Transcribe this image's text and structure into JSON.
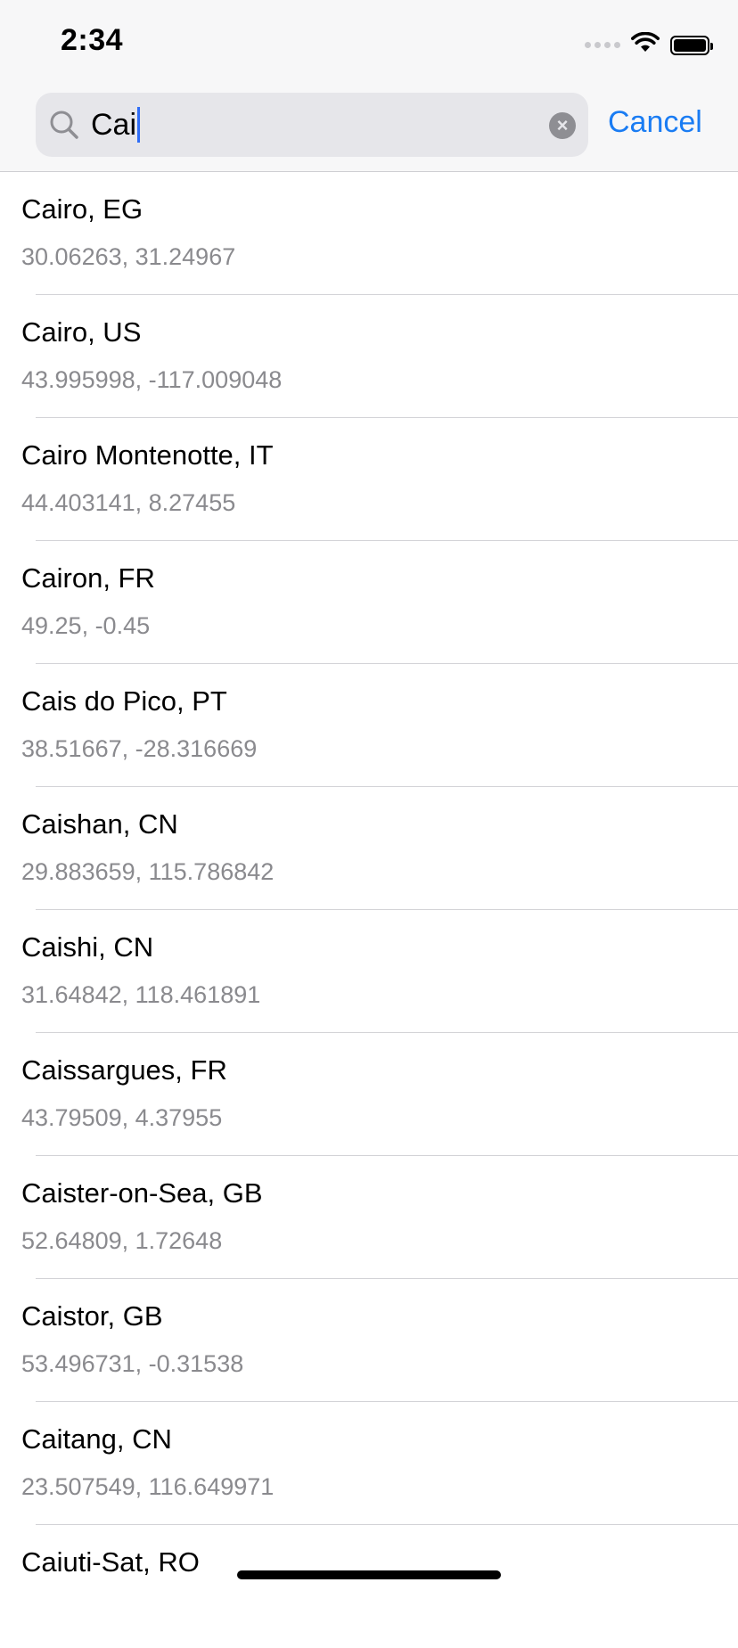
{
  "status_bar": {
    "time": "2:34",
    "icons": [
      "signal-dots-icon",
      "wifi-icon",
      "battery-icon"
    ]
  },
  "search": {
    "query": "Cai",
    "cancel_label": "Cancel",
    "icon": "search-icon",
    "clear_icon": "clear-icon"
  },
  "colors": {
    "accent": "#1a7cf3",
    "caret": "#2f6df6",
    "secondary_text": "#8a8a8e",
    "header_bg": "#f7f7f8",
    "search_bg": "#e6e6ea"
  },
  "results": [
    {
      "title": "Cairo, EG",
      "coords": "30.06263, 31.24967"
    },
    {
      "title": "Cairo, US",
      "coords": "43.995998, -117.009048"
    },
    {
      "title": "Cairo Montenotte, IT",
      "coords": "44.403141, 8.27455"
    },
    {
      "title": "Cairon, FR",
      "coords": "49.25, -0.45"
    },
    {
      "title": "Cais do Pico, PT",
      "coords": "38.51667, -28.316669"
    },
    {
      "title": "Caishan, CN",
      "coords": "29.883659, 115.786842"
    },
    {
      "title": "Caishi, CN",
      "coords": "31.64842, 118.461891"
    },
    {
      "title": "Caissargues, FR",
      "coords": "43.79509, 4.37955"
    },
    {
      "title": "Caister-on-Sea, GB",
      "coords": "52.64809, 1.72648"
    },
    {
      "title": "Caistor, GB",
      "coords": "53.496731, -0.31538"
    },
    {
      "title": "Caitang, CN",
      "coords": "23.507549, 116.649971"
    },
    {
      "title": "Caiuti-Sat, RO",
      "coords": ""
    }
  ]
}
